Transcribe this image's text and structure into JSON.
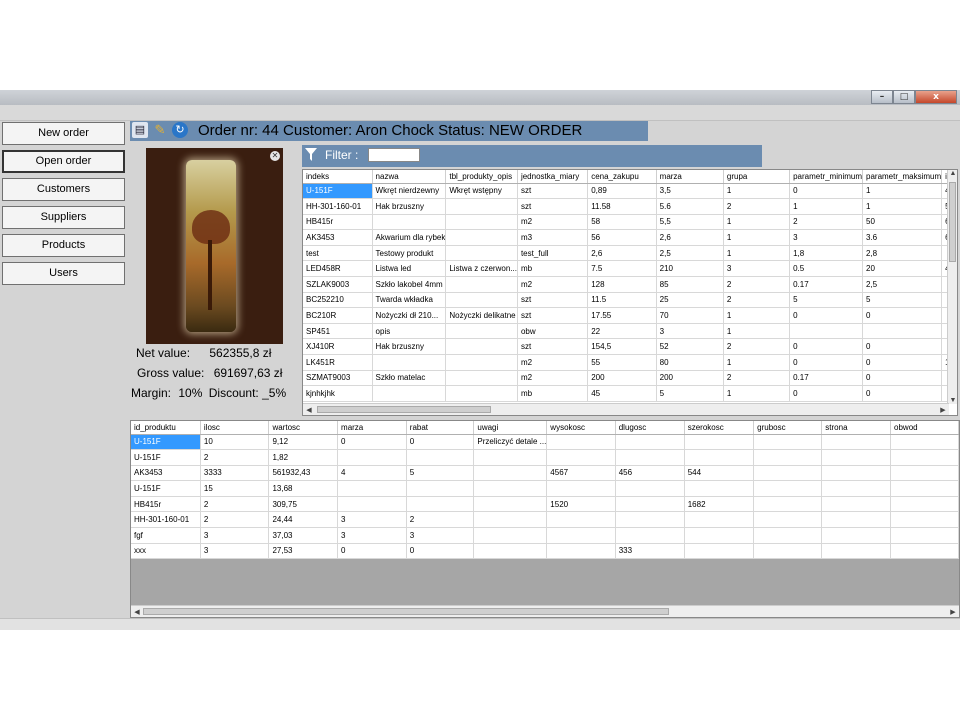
{
  "window": {
    "controls": {
      "minimize": "–",
      "maximize": "□",
      "close": "x"
    }
  },
  "sidebar": {
    "items": [
      {
        "label": "New order"
      },
      {
        "label": "Open order"
      },
      {
        "label": "Customers"
      },
      {
        "label": "Suppliers"
      },
      {
        "label": "Products"
      },
      {
        "label": "Users"
      }
    ]
  },
  "header": {
    "title": "Order nr: 44 Customer: Aron Chock  Status: NEW ORDER",
    "icons": [
      "printer-icon",
      "pencil-icon",
      "refresh-icon"
    ]
  },
  "summary": {
    "net_label": "Net  value:",
    "net_value": "562355,8 zł",
    "gross_label": "Gross value:",
    "gross_value": "691697,63 zł",
    "margin_label": "Margin:",
    "margin_value": "10%",
    "discount_label": "Discount:",
    "discount_value": "_5%"
  },
  "filter": {
    "label": "Filter :",
    "value": ""
  },
  "products_grid": {
    "columns": [
      "indeks",
      "nazwa",
      "tbl_produkty_opis",
      "jednostka_miary",
      "cena_zakupu",
      "marza",
      "grupa",
      "parametr_minimum",
      "parametr_maksimum",
      "id"
    ],
    "rows": [
      [
        "U-151F",
        "Wkręt nierdzewny",
        "Wkręt wstępny",
        "szt",
        "0,89",
        "3,5",
        "1",
        "0",
        "1",
        "4"
      ],
      [
        "HH-301-160-01",
        "Hak brzuszny",
        "",
        "szt",
        "11.58",
        "5.6",
        "2",
        "1",
        "1",
        "5"
      ],
      [
        "HB415r",
        "",
        "",
        "m2",
        "58",
        "5,5",
        "1",
        "2",
        "50",
        "6"
      ],
      [
        "AK3453",
        "Akwarium dla rybek",
        "",
        "m3",
        "56",
        "2,6",
        "1",
        "3",
        "3.6",
        "6"
      ],
      [
        "test",
        "Testowy produkt",
        "",
        "test_full",
        "2,6",
        "2,5",
        "1",
        "1,8",
        "2,8",
        ""
      ],
      [
        "LED458R",
        "Listwa led",
        "Listwa z czerwon...",
        "mb",
        "7.5",
        "210",
        "3",
        "0.5",
        "20",
        "4"
      ],
      [
        "SZLAK9003",
        "Szkło lakobel 4mm",
        "",
        "m2",
        "128",
        "85",
        "2",
        "0.17",
        "2,5",
        ""
      ],
      [
        "BC252210",
        "Twarda wkładka",
        "",
        "szt",
        "11.5",
        "25",
        "2",
        "5",
        "5",
        ""
      ],
      [
        "BC210R",
        "Nożyczki dł 210...",
        "Nożyczki delikatne",
        "szt",
        "17.55",
        "70",
        "1",
        "0",
        "0",
        ""
      ],
      [
        "SP451",
        "opis",
        "",
        "obw",
        "22",
        "3",
        "1",
        "",
        "",
        ""
      ],
      [
        "XJ410R",
        "Hak brzuszny",
        "",
        "szt",
        "154,5",
        "52",
        "2",
        "0",
        "0",
        ""
      ],
      [
        "LK451R",
        "",
        "",
        "m2",
        "55",
        "80",
        "1",
        "0",
        "0",
        "10"
      ],
      [
        "SZMAT9003",
        "Szkło matelac",
        "",
        "m2",
        "200",
        "200",
        "2",
        "0.17",
        "0",
        ""
      ],
      [
        "kjnhkjhk",
        "",
        "",
        "mb",
        "45",
        "5",
        "1",
        "0",
        "0",
        ""
      ]
    ]
  },
  "order_items_grid": {
    "columns": [
      "id_produktu",
      "ilosc",
      "wartosc",
      "marza",
      "rabat",
      "uwagi",
      "wysokosc",
      "dlugosc",
      "szerokosc",
      "grubosc",
      "strona",
      "obwod"
    ],
    "rows": [
      [
        "U-151F",
        "10",
        "9,12",
        "0",
        "0",
        "Przeliczyć detale ...",
        "",
        "",
        "",
        "",
        "",
        ""
      ],
      [
        "U-151F",
        "2",
        "1,82",
        "",
        "",
        "",
        "",
        "",
        "",
        "",
        "",
        ""
      ],
      [
        "AK3453",
        "3333",
        "561932,43",
        "4",
        "5",
        "",
        "4567",
        "456",
        "544",
        "",
        "",
        ""
      ],
      [
        "U-151F",
        "15",
        "13,68",
        "",
        "",
        "",
        "",
        "",
        "",
        "",
        "",
        ""
      ],
      [
        "HB415r",
        "2",
        "309,75",
        "",
        "",
        "",
        "1520",
        "",
        "1682",
        "",
        "",
        ""
      ],
      [
        "HH-301-160-01",
        "2",
        "24,44",
        "3",
        "2",
        "",
        "",
        "",
        "",
        "",
        "",
        ""
      ],
      [
        "fgf",
        "3",
        "37,03",
        "3",
        "3",
        "",
        "",
        "",
        "",
        "",
        "",
        ""
      ],
      [
        "xxx",
        "3",
        "27,53",
        "0",
        "0",
        "",
        "",
        "333",
        "",
        "",
        "",
        ""
      ]
    ]
  },
  "colors": {
    "accent": "#6b8cb0",
    "selection": "#3399ff"
  }
}
